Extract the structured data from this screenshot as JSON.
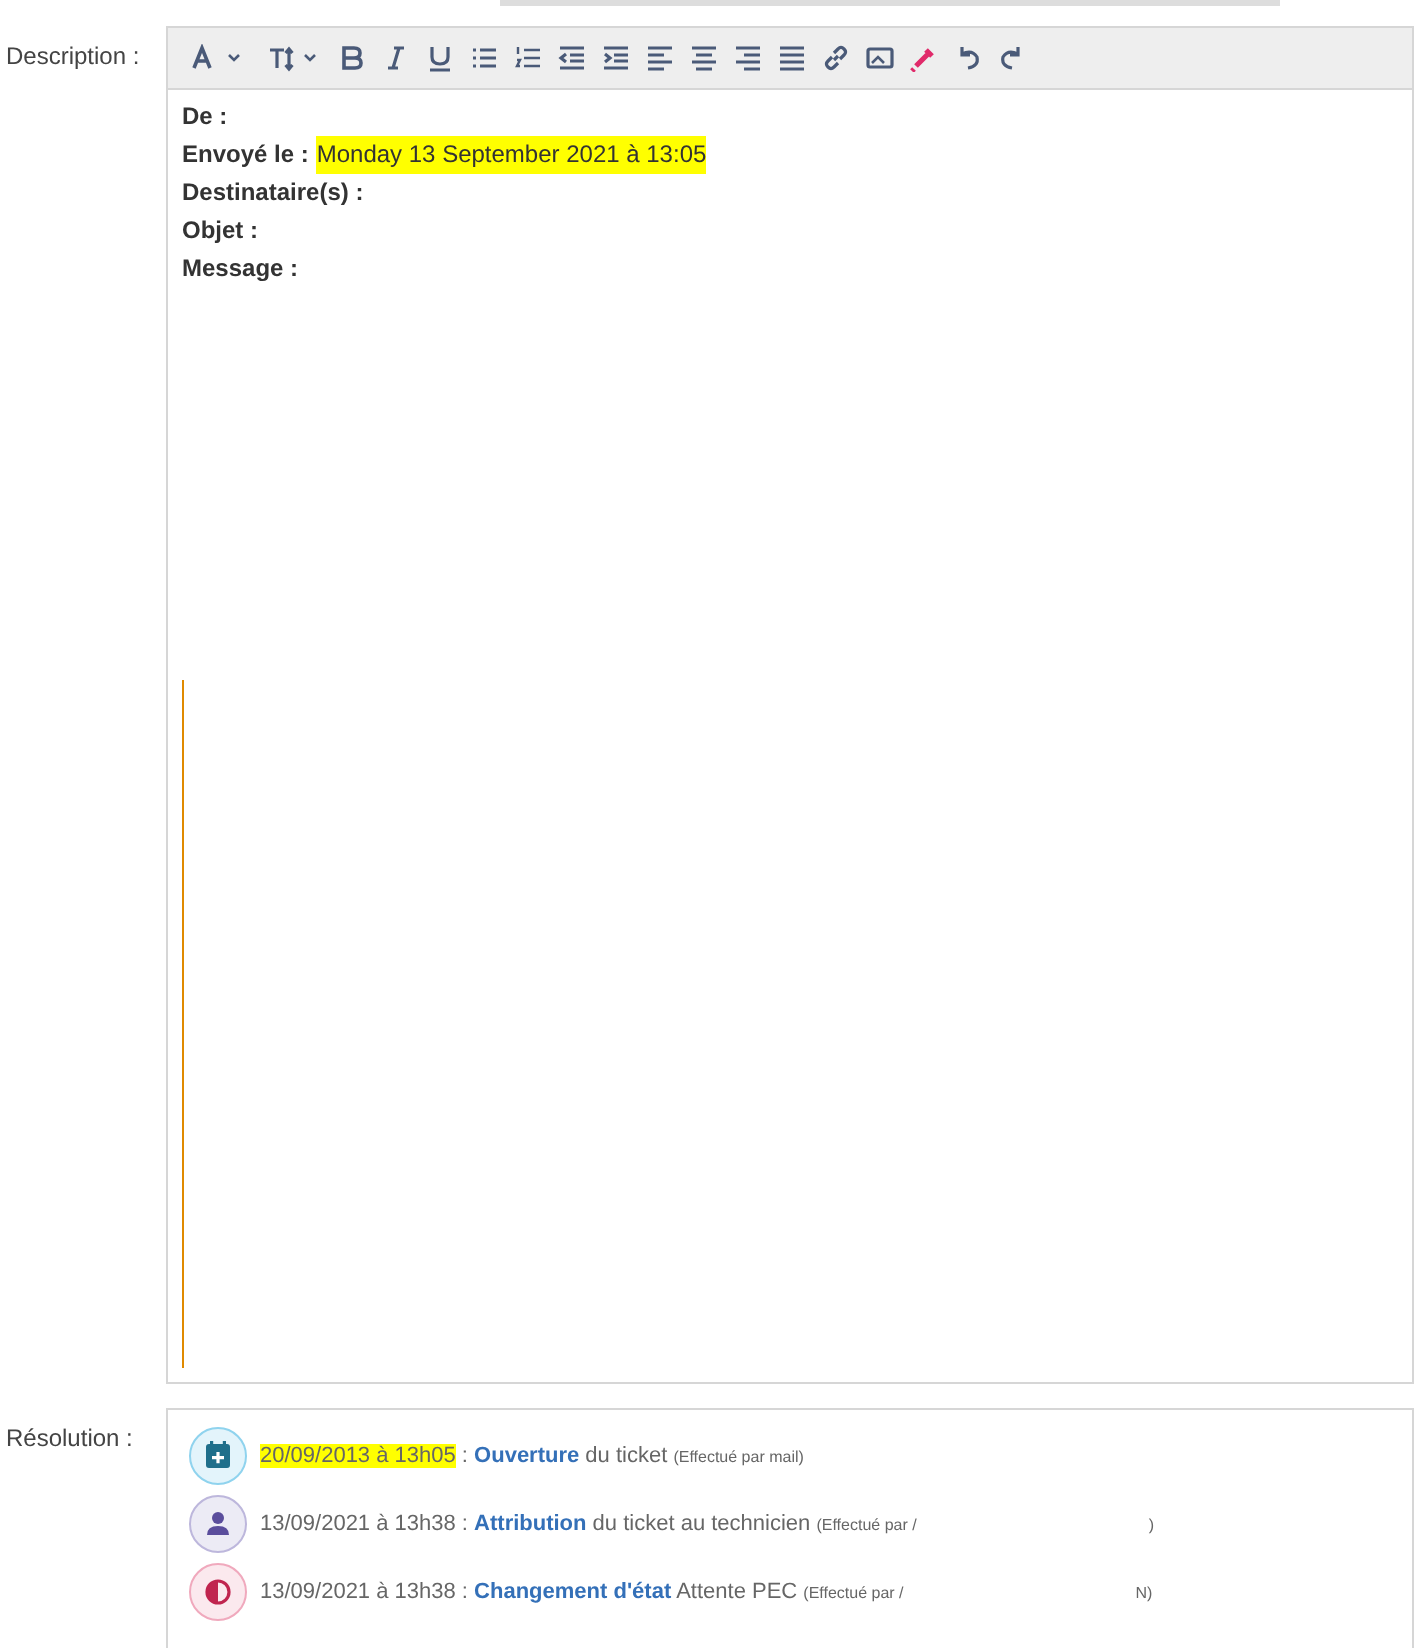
{
  "description": {
    "label": "Description :",
    "toolbar": [
      {
        "kind": "font-color",
        "caret": true
      },
      {
        "kind": "text-size",
        "caret": true
      },
      {
        "kind": "bold"
      },
      {
        "kind": "italic"
      },
      {
        "kind": "underline"
      },
      {
        "kind": "bullets"
      },
      {
        "kind": "numbers"
      },
      {
        "kind": "outdent"
      },
      {
        "kind": "indent"
      },
      {
        "kind": "align-left"
      },
      {
        "kind": "align-center"
      },
      {
        "kind": "align-right"
      },
      {
        "kind": "justify"
      },
      {
        "kind": "link"
      },
      {
        "kind": "image"
      },
      {
        "kind": "marker"
      },
      {
        "kind": "undo"
      },
      {
        "kind": "redo"
      }
    ],
    "fields": [
      {
        "label": "De :"
      },
      {
        "label": "Envoyé le :",
        "value": "Monday 13 September 2021 à 13:05",
        "highlighted": true
      },
      {
        "label": "Destinataire(s) :"
      },
      {
        "label": "Objet :"
      },
      {
        "label": "Message :"
      }
    ]
  },
  "resolution": {
    "label": "Résolution :",
    "events": [
      {
        "kind": "calendar",
        "date": "20/09/2013 à 13h05",
        "highlighted": true,
        "separator": ":",
        "action": "Ouverture",
        "detail": "du ticket",
        "note": "(Effectué par mail)"
      },
      {
        "kind": "person",
        "date": "13/09/2021 à 13h38",
        "highlighted": false,
        "separator": ":",
        "action": "Attribution",
        "detail": "du ticket au technicien",
        "note": "(Effectué par /",
        "note_end": ")"
      },
      {
        "kind": "state",
        "date": "13/09/2021 à 13h38",
        "highlighted": false,
        "separator": ":",
        "action": "Changement d'état",
        "detail": "Attente PEC",
        "note": "(Effectué par /",
        "note_end": "N)"
      }
    ]
  }
}
